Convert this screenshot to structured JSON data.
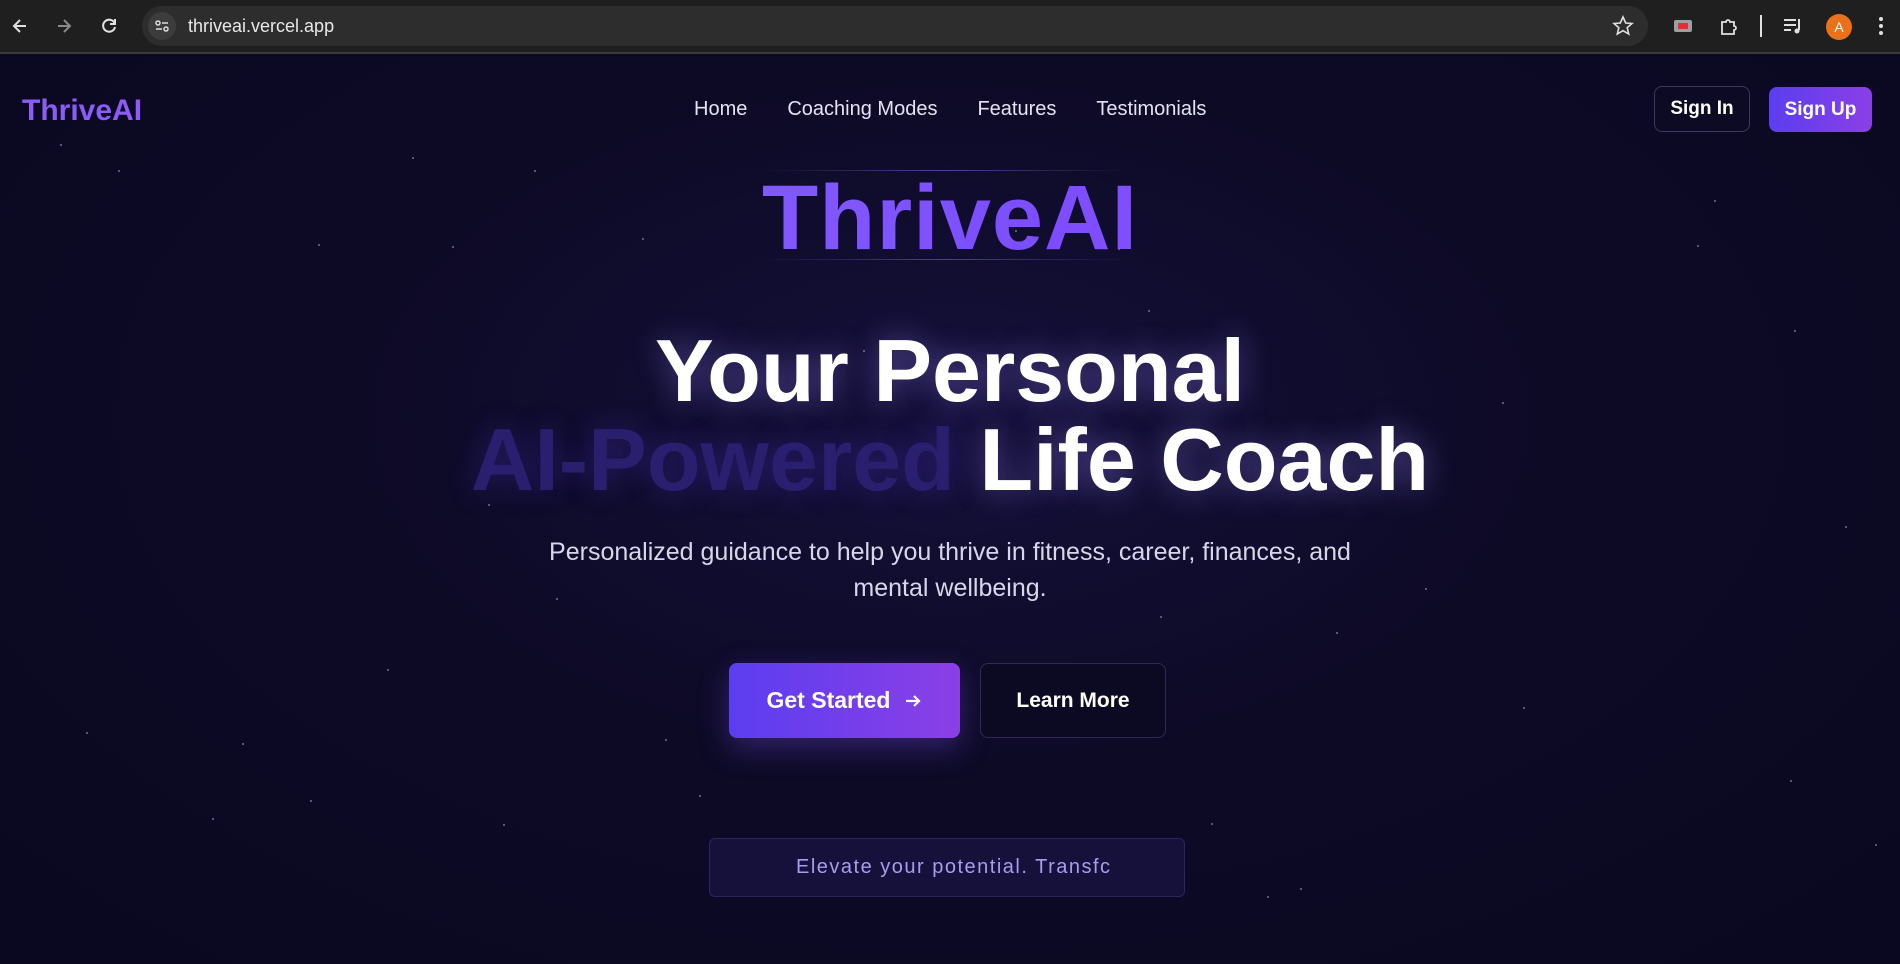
{
  "browser": {
    "url": "thriveai.vercel.app",
    "profile_initial": "A",
    "icons": [
      "back-arrow-icon",
      "forward-arrow-icon",
      "reload-icon",
      "site-info-icon",
      "bookmark-star-icon",
      "extension-icon",
      "puzzle-icon",
      "media-controls-icon",
      "more-vert-icon"
    ]
  },
  "header": {
    "brand": "ThriveAI",
    "nav": [
      "Home",
      "Coaching Modes",
      "Features",
      "Testimonials"
    ],
    "sign_in": "Sign In",
    "sign_up": "Sign Up"
  },
  "hero": {
    "logo": "ThriveAI",
    "headline_line1": "Your Personal",
    "headline_highlight": "AI-Powered",
    "headline_rest": "Life Coach",
    "subtitle": "Personalized guidance to help you thrive in fitness, career, finances, and mental wellbeing.",
    "cta_primary": "Get Started",
    "cta_primary_icon": "arrow-right-icon",
    "cta_secondary": "Learn More",
    "tagline": "Elevate your potential. Transfc"
  },
  "colors": {
    "accent": "#8b5cf6",
    "button_gradient_start": "#5b3ef0",
    "button_gradient_end": "#8b3fe6",
    "background": "#0b0820"
  }
}
